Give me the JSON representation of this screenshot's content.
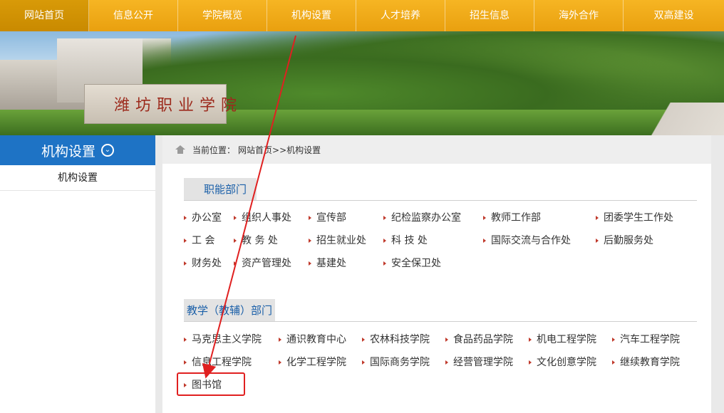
{
  "nav": {
    "items": [
      "网站首页",
      "信息公开",
      "学院概览",
      "机构设置",
      "人才培养",
      "招生信息",
      "海外合作",
      "双高建设"
    ]
  },
  "banner": {
    "stone_text": "潍坊职业学院"
  },
  "sidebar": {
    "title": "机构设置",
    "toggle_icon": "chevron-down-icon",
    "items": [
      "机构设置"
    ]
  },
  "breadcrumb": {
    "icon": "home-icon",
    "label": "当前位置：",
    "path": "网站首页>>机构设置"
  },
  "sections": [
    {
      "title": "职能部门",
      "links": [
        [
          "办公室",
          "组织人事处",
          "宣传部",
          "纪检监察办公室",
          "教师工作部",
          "团委学生工作处"
        ],
        [
          "工 会",
          "教 务 处",
          "招生就业处",
          "科 技 处",
          "国际交流与合作处",
          "后勤服务处"
        ],
        [
          "财务处",
          "资产管理处",
          "基建处",
          "安全保卫处"
        ]
      ]
    },
    {
      "title": "教学（教辅）部门",
      "links": [
        [
          "马克思主义学院",
          "通识教育中心",
          "农林科技学院",
          "食品药品学院",
          "机电工程学院",
          "汽车工程学院"
        ],
        [
          "信息工程学院",
          "化学工程学院",
          "国际商务学院",
          "经营管理学院",
          "文化创意学院",
          "继续教育学院"
        ],
        [
          "图书馆"
        ]
      ]
    }
  ],
  "annotation": {
    "box_color": "#e02020",
    "arrow_color": "#e02020"
  }
}
